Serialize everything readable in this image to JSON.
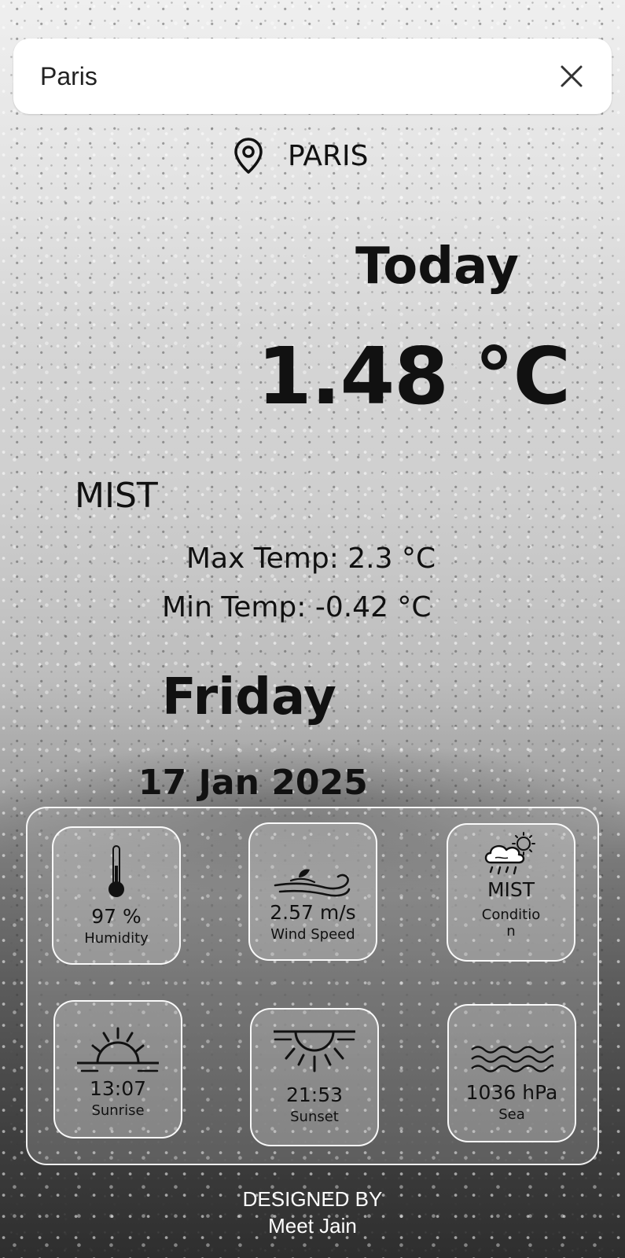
{
  "search": {
    "value": "Paris",
    "clear_icon": "close-icon"
  },
  "location": {
    "icon": "map-pin-icon",
    "name": "PARIS"
  },
  "current": {
    "heading": "Today",
    "temperature": "1.48 °C",
    "condition": "MIST",
    "max_temp": "Max Temp: 2.3 °C",
    "min_temp": "Min Temp: -0.42 °C",
    "day": "Friday",
    "date": "17 Jan 2025"
  },
  "details": {
    "humidity": {
      "icon": "thermometer-icon",
      "value": "97 %",
      "label": "Humidity"
    },
    "wind": {
      "icon": "wind-icon",
      "value": "2.57 m/s",
      "label": "Wind Speed"
    },
    "condition": {
      "icon": "cloud-rain-sun-icon",
      "value": "MIST",
      "label_line1": "Conditio",
      "label_line2": "n"
    },
    "sunrise": {
      "icon": "sunrise-icon",
      "value": "13:07",
      "label": "Sunrise"
    },
    "sunset": {
      "icon": "sunset-icon",
      "value": "21:53",
      "label": "Sunset"
    },
    "sea": {
      "icon": "waves-icon",
      "value": "1036 hPa",
      "label": "Sea"
    }
  },
  "footer": {
    "line1": "DESIGNED BY",
    "line2": "Meet Jain"
  }
}
